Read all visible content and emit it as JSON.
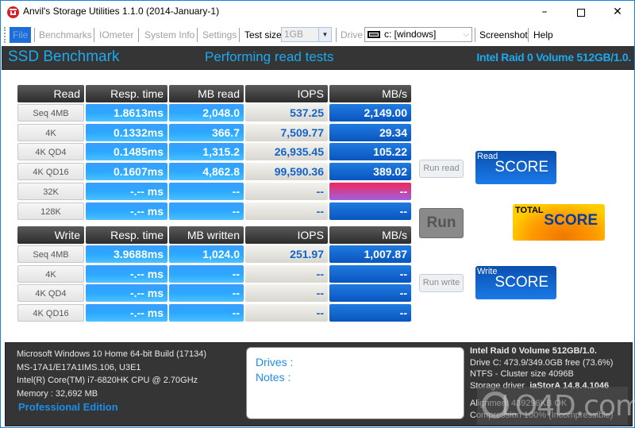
{
  "window": {
    "title": "Anvil's Storage Utilities 1.1.0 (2014-January-1)",
    "controls": {
      "minimize": "–",
      "maximize": "□",
      "close": "✕"
    }
  },
  "menu": {
    "items": [
      {
        "label": "File",
        "state": "active"
      },
      {
        "label": "Benchmarks",
        "state": "disabled"
      },
      {
        "label": "IOmeter",
        "state": "disabled"
      },
      {
        "label": "System Info",
        "state": "disabled"
      },
      {
        "label": "Settings",
        "state": "disabled"
      }
    ],
    "test_size_label": "Test size",
    "test_size_value": "1GB",
    "drive_label": "Drive",
    "drive_value": "c: [windows]",
    "screenshot_label": "Screenshot",
    "help_label": "Help"
  },
  "header": {
    "title": "SSD Benchmark",
    "status": "Performing read tests",
    "drive": "Intel Raid 0 Volume 512GB/1.0."
  },
  "read_table": {
    "headers": [
      "Read",
      "Resp. time",
      "MB read",
      "IOPS",
      "MB/s"
    ],
    "rows": [
      {
        "label": "Seq 4MB",
        "resp": "1.8613ms",
        "mb": "2,048.0",
        "iops": "537.25",
        "mbs": "2,149.00",
        "highlight": false
      },
      {
        "label": "4K",
        "resp": "0.1332ms",
        "mb": "366.7",
        "iops": "7,509.77",
        "mbs": "29.34",
        "highlight": false
      },
      {
        "label": "4K QD4",
        "resp": "0.1485ms",
        "mb": "1,315.2",
        "iops": "26,935.45",
        "mbs": "105.22",
        "highlight": false
      },
      {
        "label": "4K QD16",
        "resp": "0.1607ms",
        "mb": "4,862.8",
        "iops": "99,590.36",
        "mbs": "389.02",
        "highlight": false
      },
      {
        "label": "32K",
        "resp": "-.-- ms",
        "mb": "--",
        "iops": "--",
        "mbs": "--",
        "highlight": true
      },
      {
        "label": "128K",
        "resp": "-.-- ms",
        "mb": "--",
        "iops": "--",
        "mbs": "--",
        "highlight": false
      }
    ]
  },
  "write_table": {
    "headers": [
      "Write",
      "Resp. time",
      "MB written",
      "IOPS",
      "MB/s"
    ],
    "rows": [
      {
        "label": "Seq 4MB",
        "resp": "3.9688ms",
        "mb": "1,024.0",
        "iops": "251.97",
        "mbs": "1,007.87"
      },
      {
        "label": "4K",
        "resp": "-.-- ms",
        "mb": "--",
        "iops": "--",
        "mbs": "--"
      },
      {
        "label": "4K QD4",
        "resp": "-.-- ms",
        "mb": "--",
        "iops": "--",
        "mbs": "--"
      },
      {
        "label": "4K QD16",
        "resp": "-.-- ms",
        "mb": "--",
        "iops": "--",
        "mbs": "--"
      }
    ]
  },
  "actions": {
    "run_read": "Run read",
    "run": "Run",
    "run_write": "Run write"
  },
  "scores": {
    "read": {
      "caption": "Read",
      "label": "SCORE"
    },
    "total": {
      "caption": "TOTAL",
      "label": "SCORE"
    },
    "write": {
      "caption": "Write",
      "label": "SCORE"
    }
  },
  "footer": {
    "system": [
      "Microsoft Windows 10 Home 64-bit Build (17134)",
      "MS-17A1/E17A1IMS.106, U3E1",
      "Intel(R) Core(TM) i7-6820HK CPU @ 2.70GHz",
      "Memory : 32,692 MB"
    ],
    "edition": "Professional Edition",
    "notes": {
      "drives": "Drives :",
      "notes": "Notes :"
    },
    "drive_info": {
      "name": "Intel Raid 0 Volume 512GB/1.0.",
      "free": "Drive C: 473.9/349.0GB free (73.6%)",
      "fs": "NTFS - Cluster size 4096B",
      "driver_label": "Storage driver",
      "driver_value": "iaStorA 14.8.4.1046",
      "alignment": "Alignment 439296KB OK",
      "compression": "Compression 100% (Incompressible)"
    }
  },
  "watermark": "LO4D.com"
}
